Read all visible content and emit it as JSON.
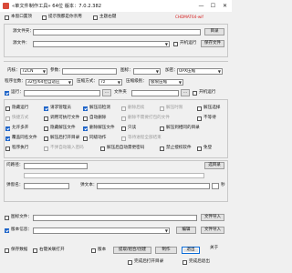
{
  "window": {
    "title": "«单文件制作工具» 64位 版本：7.0.2.382",
    "minimize": "—",
    "maximize": "☐",
    "close": "✕"
  },
  "top_options": {
    "always_on_top": "本窗口置顶",
    "prompt_remember": "提示我都是你亲用",
    "theme_label": "主题右键",
    "brand": "CHDMAT64-wif"
  },
  "source": {
    "folder_label": "源文件夹：",
    "folder_value": "",
    "browse": "目录",
    "file_label": "源文件：",
    "file_value": "",
    "startup_checkbox": "开机运行",
    "save_config": "保存文件"
  },
  "compress": {
    "core_label": "内核：",
    "core_value": "7ZCN",
    "params_label": "参数：",
    "params_value": "",
    "icon_label": "图标：",
    "icon_value": "",
    "encrypt_label": "加密：",
    "encrypt_value": "UPX压缩"
  },
  "program": {
    "bits_label": "程序位数：",
    "bits_value": "32位/64位自适应",
    "method_label": "压缩方式：",
    "method_value": "7z",
    "level_label": "压缩级别：",
    "level_value": "极限压缩"
  },
  "run": {
    "run_checkbox": "运行：",
    "run_value": "",
    "extra": "...",
    "args_label": "文件夹",
    "args_value": "...",
    "run_hidden": "开机运行"
  },
  "options": [
    [
      {
        "label": "隐藏运行",
        "checked": false,
        "disabled": false
      },
      {
        "label": "请求管理员",
        "checked": true,
        "disabled": false
      },
      {
        "label": "解压前检测",
        "checked": true,
        "disabled": false
      },
      {
        "label": "删除后续",
        "checked": false,
        "disabled": true
      },
      {
        "label": "解压时限",
        "checked": false,
        "disabled": true
      },
      {
        "label": "解压选择",
        "checked": false,
        "disabled": false
      }
    ],
    [
      {
        "label": "快捷方式",
        "checked": false,
        "disabled": true
      },
      {
        "label": "调用可执行文件",
        "checked": false,
        "disabled": false
      },
      {
        "label": "自动删除",
        "checked": false,
        "disabled": false
      },
      {
        "label": "删除不需要打包的文件",
        "checked": false,
        "disabled": true
      },
      {
        "label": "不等待",
        "checked": false,
        "disabled": false
      }
    ],
    [
      {
        "label": "允许多开",
        "checked": true,
        "disabled": false
      },
      {
        "label": "隐藏解压文件",
        "checked": false,
        "disabled": false
      },
      {
        "label": "删除解压文件",
        "checked": true,
        "disabled": false
      },
      {
        "label": "只读",
        "checked": false,
        "disabled": false
      },
      {
        "label": "解压到相同的目录",
        "checked": false,
        "disabled": false
      }
    ],
    [
      {
        "label": "覆盖同名文件",
        "checked": true,
        "disabled": false
      },
      {
        "label": "解压后打开目录",
        "checked": false,
        "disabled": false
      },
      {
        "label": "同级动作",
        "checked": false,
        "disabled": false
      },
      {
        "label": "等待进程全部结束",
        "checked": false,
        "disabled": true
      }
    ],
    [
      {
        "label": "程序执行",
        "checked": false,
        "disabled": false
      },
      {
        "label": "不弹自动输入密码",
        "checked": false,
        "disabled": true
      },
      {
        "label": "解压后自动需更密码",
        "checked": false,
        "disabled": false
      },
      {
        "label": "禁止授权软件",
        "checked": false,
        "disabled": false
      },
      {
        "label": "免登",
        "checked": false,
        "disabled": false
      }
    ]
  ],
  "decompress": {
    "path_label": "问路径：",
    "path_value": "",
    "path_btn": "选目录",
    "interval_label": "弹窗名：",
    "interval_value": "",
    "comment_label": "弹文本：",
    "comment_value": "",
    "unit": "秒"
  },
  "icon_file": {
    "checkbox": "图标文件：",
    "value": "",
    "btn": "文件导入"
  },
  "version_info": {
    "checkbox": "版本信息：",
    "value": "",
    "edit": "编辑",
    "btn": "文件导入"
  },
  "bottom": {
    "save_settings": "保存数据",
    "right_click_menu": "右键关联打开",
    "version_checkbox": "版本",
    "make_btn": "提取/组合/创建",
    "create_btn": "制作",
    "exit_btn": "退出",
    "about": "关于",
    "open_after": "完成后打开目录",
    "close_after": "完成后退出"
  }
}
